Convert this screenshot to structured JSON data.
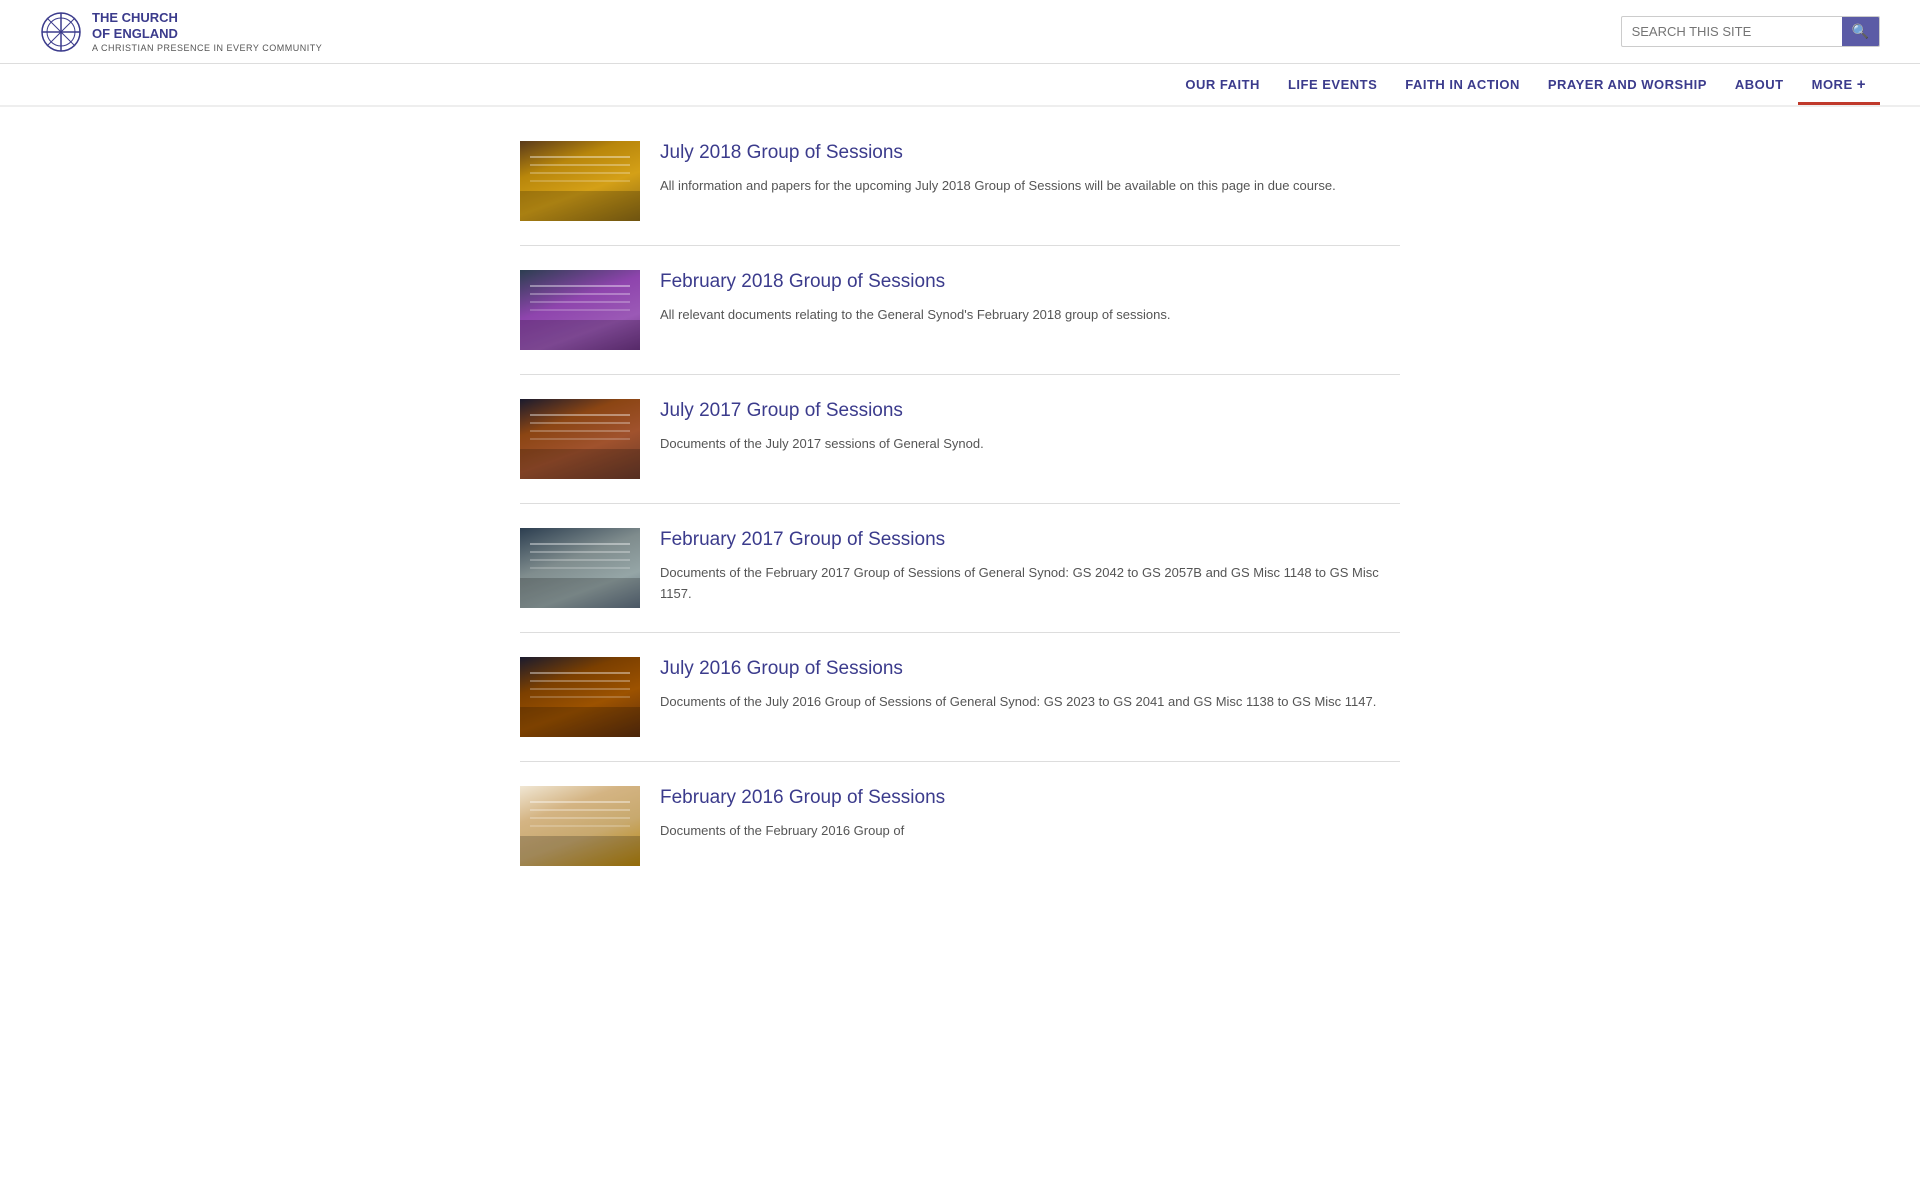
{
  "header": {
    "logo_title": "THE CHURCH\nOF ENGLAND",
    "logo_subtitle": "A CHRISTIAN PRESENCE IN EVERY COMMUNITY",
    "search_placeholder": "SEARCH THIS SITE"
  },
  "nav": {
    "items": [
      {
        "label": "OUR FAITH",
        "id": "our-faith"
      },
      {
        "label": "LIFE EVENTS",
        "id": "life-events"
      },
      {
        "label": "FAITH IN ACTION",
        "id": "faith-in-action"
      },
      {
        "label": "PRAYER AND WORSHIP",
        "id": "prayer-worship"
      },
      {
        "label": "ABOUT",
        "id": "about"
      },
      {
        "label": "MORE",
        "id": "more",
        "extra": "+"
      }
    ]
  },
  "sessions": [
    {
      "id": "july-2018",
      "title": "July 2018 Group of Sessions",
      "description": "All information and papers for the upcoming July 2018 Group of Sessions will be available on this page in due course.",
      "thumb_type": "type-a"
    },
    {
      "id": "feb-2018",
      "title": "February 2018 Group of Sessions",
      "description": "All relevant documents relating to the General Synod's February 2018 group of sessions.",
      "thumb_type": "type-b"
    },
    {
      "id": "july-2017",
      "title": "July 2017 Group of Sessions",
      "description": "Documents of the July 2017 sessions of General Synod.",
      "thumb_type": "type-c"
    },
    {
      "id": "feb-2017",
      "title": "February 2017 Group of Sessions",
      "description": "Documents of the February 2017 Group of Sessions of General Synod: GS 2042 to GS 2057B and GS Misc 1148 to GS Misc 1157.",
      "thumb_type": "type-d"
    },
    {
      "id": "july-2016",
      "title": "July 2016 Group of Sessions",
      "description": "Documents of the July 2016 Group of Sessions of General Synod: GS 2023 to GS 2041 and GS Misc 1138 to GS Misc 1147.",
      "thumb_type": "type-e"
    },
    {
      "id": "feb-2016",
      "title": "February 2016 Group of Sessions",
      "description": "Documents of the February 2016 Group of",
      "thumb_type": "type-f"
    }
  ]
}
